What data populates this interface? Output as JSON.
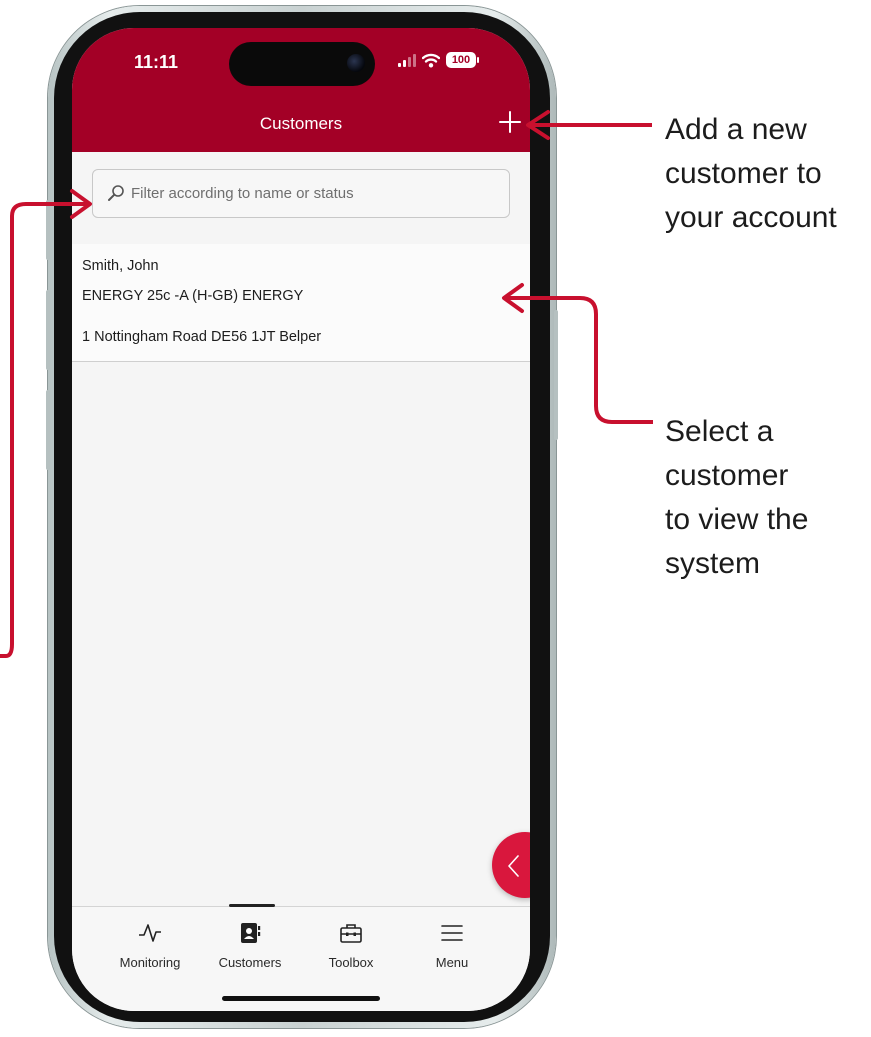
{
  "status_bar": {
    "time": "11:11",
    "battery": "100"
  },
  "header": {
    "title": "Customers",
    "add_icon": "plus-icon",
    "background": "#a30026"
  },
  "search": {
    "placeholder": "Filter according to name or status",
    "value": "",
    "icon": "search-icon"
  },
  "customers": [
    {
      "name": "Smith, John",
      "device": "ENERGY 25c -A (H-GB) ENERGY",
      "address": "1 Nottingham Road DE56 1JT Belper"
    }
  ],
  "fab": {
    "icon": "chevron-left-icon",
    "color": "#d9173d"
  },
  "tabbar": {
    "active": "Customers",
    "tabs": [
      {
        "label": "Monitoring",
        "icon": "pulse-icon"
      },
      {
        "label": "Customers",
        "icon": "contacts-icon"
      },
      {
        "label": "Toolbox",
        "icon": "toolbox-icon"
      },
      {
        "label": "Menu",
        "icon": "hamburger-icon"
      }
    ]
  },
  "annotations": {
    "add_customer": [
      "Add a new",
      "customer to",
      "your account"
    ],
    "select_customer": [
      "Select a",
      "customer",
      "to view the",
      "system"
    ],
    "arrow_color": "#c8102e"
  }
}
